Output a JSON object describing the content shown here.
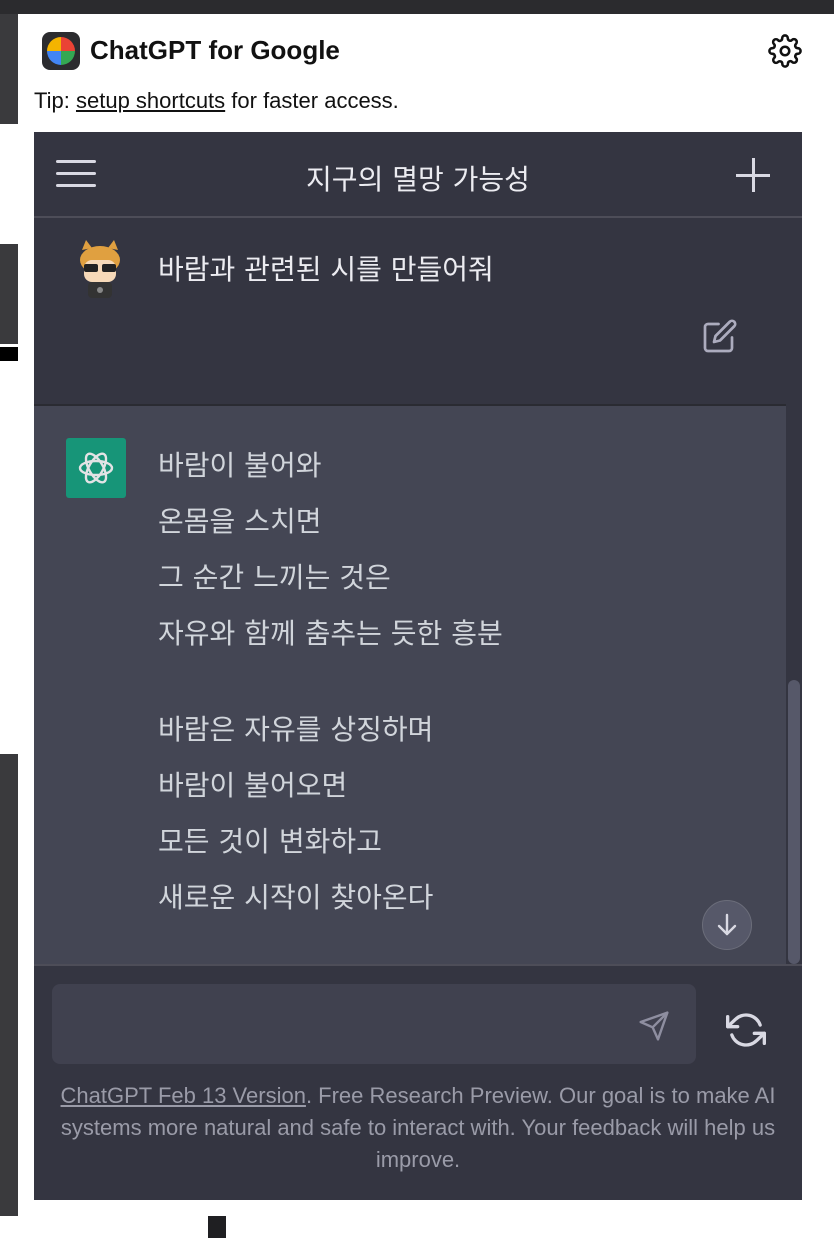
{
  "extension": {
    "title": "ChatGPT for Google",
    "tip_prefix": "Tip: ",
    "tip_link": "setup shortcuts",
    "tip_suffix": " for faster access."
  },
  "chat": {
    "conversation_title": "지구의 멸망 가능성",
    "user_message": "바람과 관련된 시를 만들어줘",
    "assistant_stanza1": [
      "바람이 불어와",
      "온몸을 스치면",
      "그 순간 느끼는 것은",
      "자유와 함께 춤추는 듯한 흥분"
    ],
    "assistant_stanza2": [
      "바람은 자유를 상징하며",
      "바람이 불어오면",
      "모든 것이 변화하고",
      "새로운 시작이 찾아온다"
    ],
    "input_placeholder": ""
  },
  "footer": {
    "version_link": "ChatGPT Feb 13 Version",
    "text": ". Free Research Preview. Our goal is to make AI systems more natural and safe to interact with. Your feedback will help us improve."
  },
  "icons": {
    "settings": "gear-icon",
    "menu": "hamburger-icon",
    "new_chat": "plus-icon",
    "edit": "edit-icon",
    "assistant": "openai-logo-icon",
    "scroll_down": "arrow-down-icon",
    "send": "send-icon",
    "regenerate": "refresh-icon"
  },
  "colors": {
    "chat_bg": "#343541",
    "assistant_bg": "#444654",
    "assistant_avatar": "#10a37f",
    "input_bg": "#40414f"
  }
}
